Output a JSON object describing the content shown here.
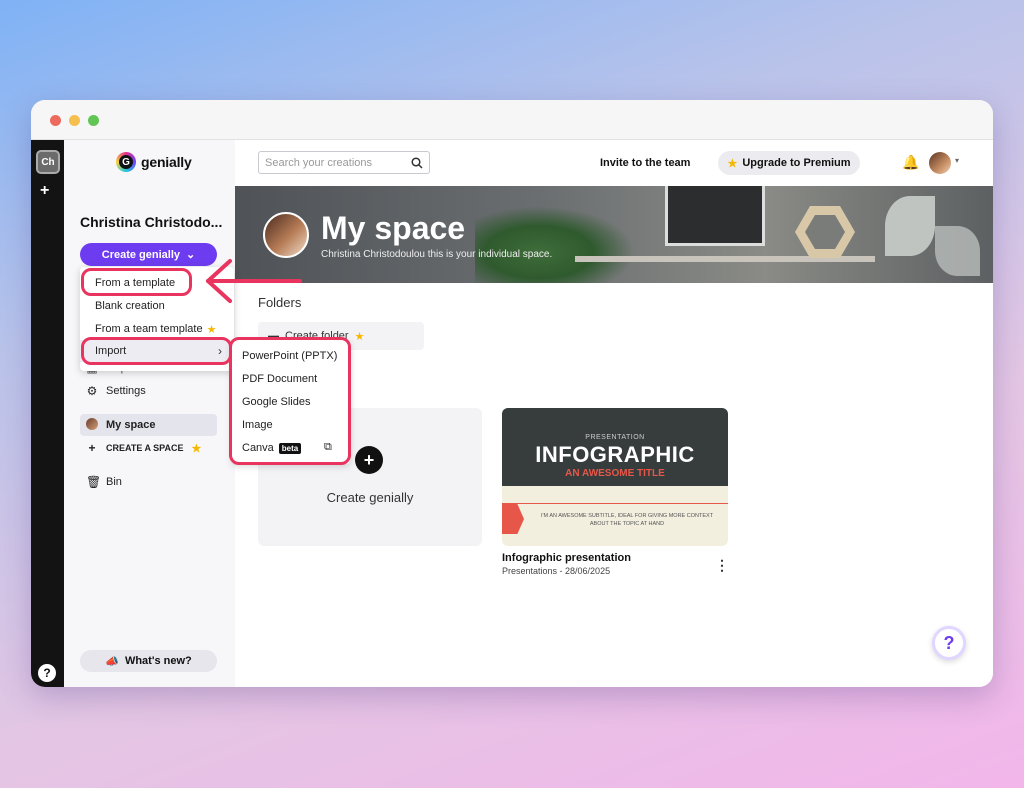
{
  "workspace": {
    "initials": "Ch",
    "help": "?"
  },
  "logo": {
    "text": "genially",
    "mark": "G"
  },
  "sidebar": {
    "username": "Christina Christodo...",
    "create_button": "Create genially",
    "partial_item": "Inspiration",
    "items": [
      {
        "label": "Settings",
        "icon": "gear-icon"
      },
      {
        "label": "My space",
        "icon": "avatar"
      },
      {
        "label": "CREATE A SPACE",
        "icon": "plus-icon"
      },
      {
        "label": "Bin",
        "icon": "trash-icon"
      }
    ],
    "whats_new": "What's new?"
  },
  "header": {
    "search_placeholder": "Search your creations",
    "invite": "Invite to the team",
    "upgrade": "Upgrade to Premium"
  },
  "banner": {
    "title": "My space",
    "subtitle": "Christina Christodoulou this is your individual space."
  },
  "content": {
    "folders_heading": "Folders",
    "create_folder": "Create folder",
    "create_card_label": "Create genially",
    "creation": {
      "pretitle": "PRESENTATION",
      "headline": "INFOGRAPHIC",
      "subheadline": "AN AWESOME TITLE",
      "body": "I'M AN AWESOME SUBTITLE, IDEAL FOR GIVING MORE CONTEXT ABOUT THE TOPIC AT HAND",
      "title": "Infographic presentation",
      "meta": "Presentations - 28/06/2025"
    }
  },
  "create_menu": {
    "items": [
      "From a template",
      "Blank creation",
      "From a team template",
      "Import"
    ]
  },
  "import_menu": {
    "items": [
      "PowerPoint (PPTX)",
      "PDF Document",
      "Google Slides",
      "Image",
      "Canva"
    ],
    "badge": "beta"
  },
  "colors": {
    "accent": "#6e3cf0",
    "highlight": "#e8345e",
    "premium_star": "#f5b700"
  }
}
